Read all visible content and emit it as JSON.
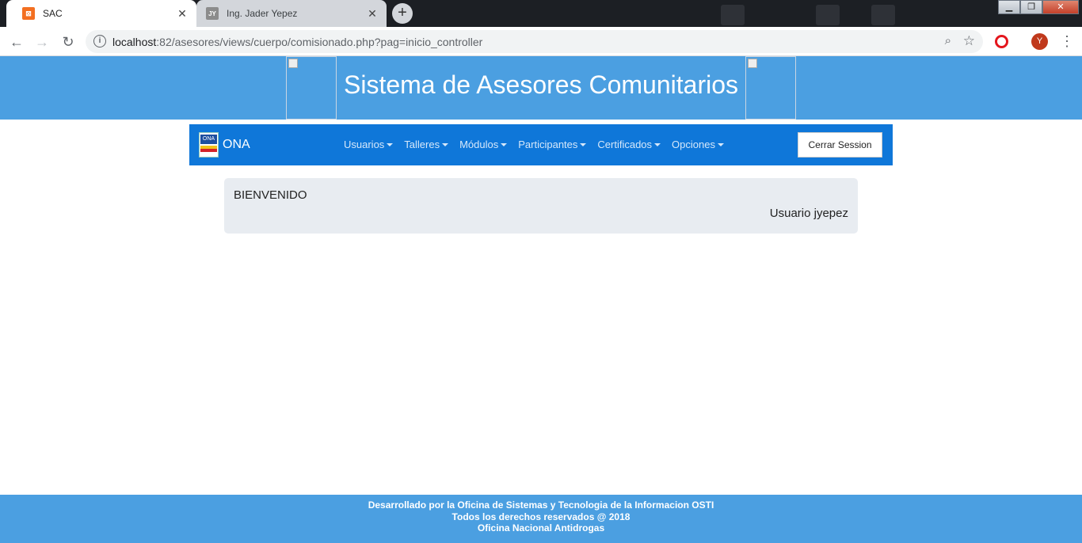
{
  "browser": {
    "tabs": [
      {
        "favicon": "xampp-favicon",
        "favicon_text": "⊠",
        "title": "SAC",
        "active": true
      },
      {
        "favicon": "user-initials-favicon",
        "favicon_text": "JY",
        "title": "Ing. Jader Yepez",
        "active": false
      }
    ],
    "new_tab_label": "+",
    "url_host": "localhost",
    "url_rest": ":82/asesores/views/cuerpo/comisionado.php?pag=inicio_controller",
    "profile_initial": "Y"
  },
  "banner": {
    "title": "Sistema de Asesores Comunitarios",
    "color": "#4b9fe1"
  },
  "navbar": {
    "brand": "ONA",
    "brand_logo_text": "ONA",
    "color": "#0f77d9",
    "menu": [
      "Usuarios",
      "Talleres",
      "Módulos",
      "Participantes",
      "Certificados",
      "Opciones"
    ],
    "logout_label": "Cerrar Session"
  },
  "welcome": {
    "heading": "BIENVENIDO",
    "user_text": "Usuario jyepez"
  },
  "footer": {
    "line1": "Desarrollado por la Oficina de Sistemas y Tecnologia de la Informacion OSTI",
    "line2": "Todos los derechos reservados @ 2018",
    "line3": "Oficina Nacional Antidrogas"
  }
}
